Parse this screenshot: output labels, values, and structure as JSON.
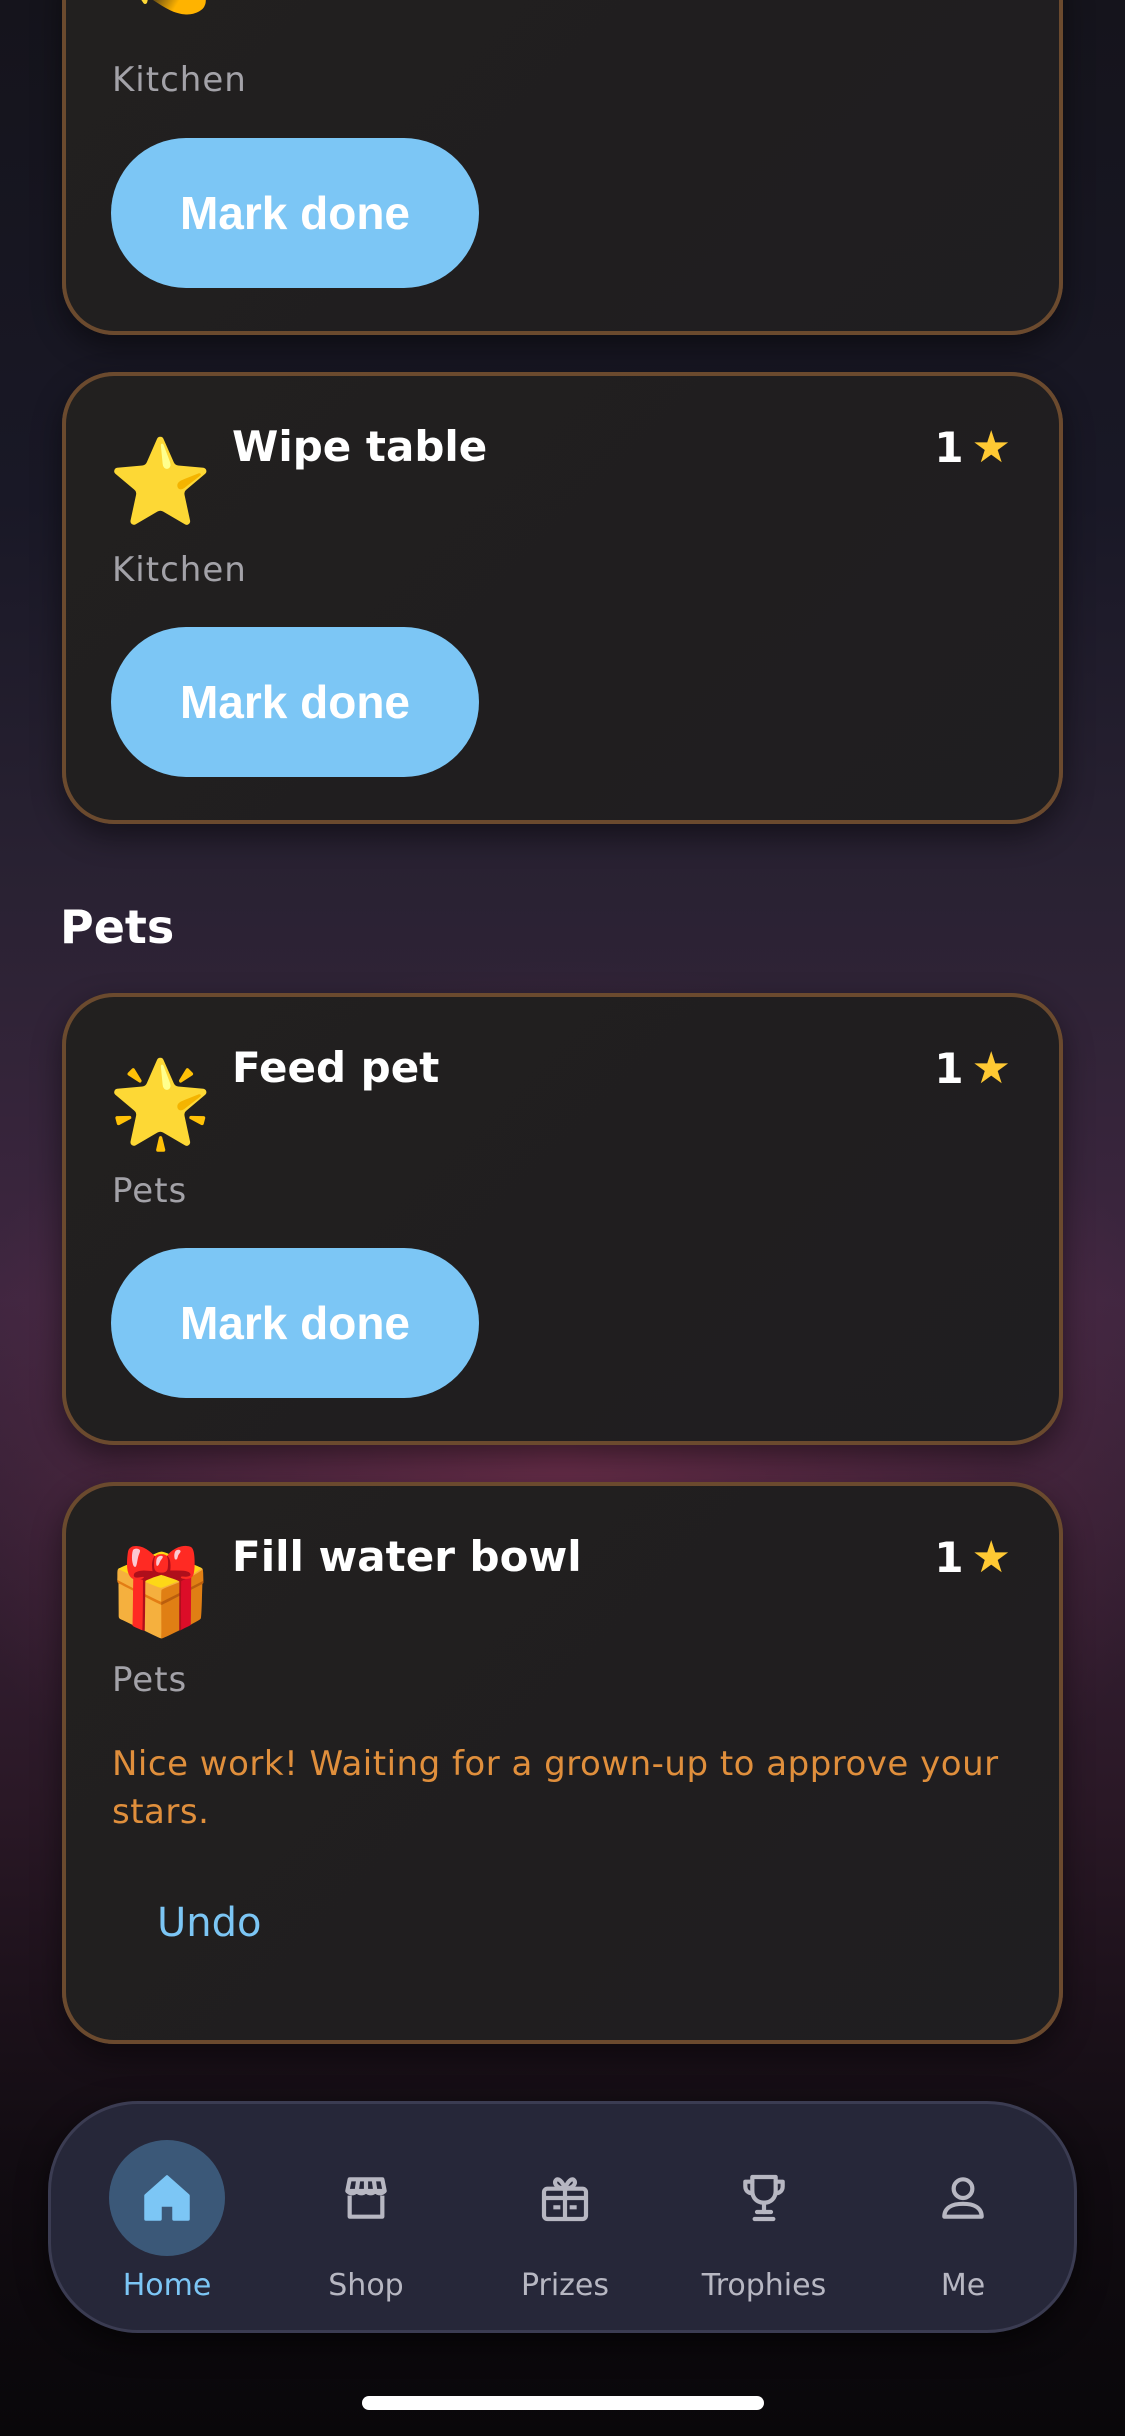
{
  "cards": [
    {
      "title": "",
      "stars": "",
      "category": "Kitchen",
      "button": "Mark done",
      "emoji": "💫"
    },
    {
      "title": "Wipe table",
      "stars": "1",
      "category": "Kitchen",
      "button": "Mark done",
      "emoji": "⭐"
    },
    {
      "title": "Feed pet",
      "stars": "1",
      "category": "Pets",
      "button": "Mark done",
      "emoji": "🌟"
    },
    {
      "title": "Fill water bowl",
      "stars": "1",
      "category": "Pets",
      "message": "Nice work! Waiting for a grown-up to approve your stars.",
      "undo": "Undo",
      "emoji": "🎁"
    }
  ],
  "sections": {
    "pets": "Pets"
  },
  "star_symbol": "★",
  "nav": {
    "items": [
      {
        "label": "Home",
        "icon": "home-icon",
        "active": true
      },
      {
        "label": "Shop",
        "icon": "shop-icon",
        "active": false
      },
      {
        "label": "Prizes",
        "icon": "gift-icon",
        "active": false
      },
      {
        "label": "Trophies",
        "icon": "trophy-icon",
        "active": false
      },
      {
        "label": "Me",
        "icon": "user-icon",
        "active": false
      }
    ]
  },
  "colors": {
    "accent": "#7cc6f5",
    "star": "#ffc933",
    "warning_text": "#e08f3c",
    "card_border": "#6b4a2e"
  }
}
